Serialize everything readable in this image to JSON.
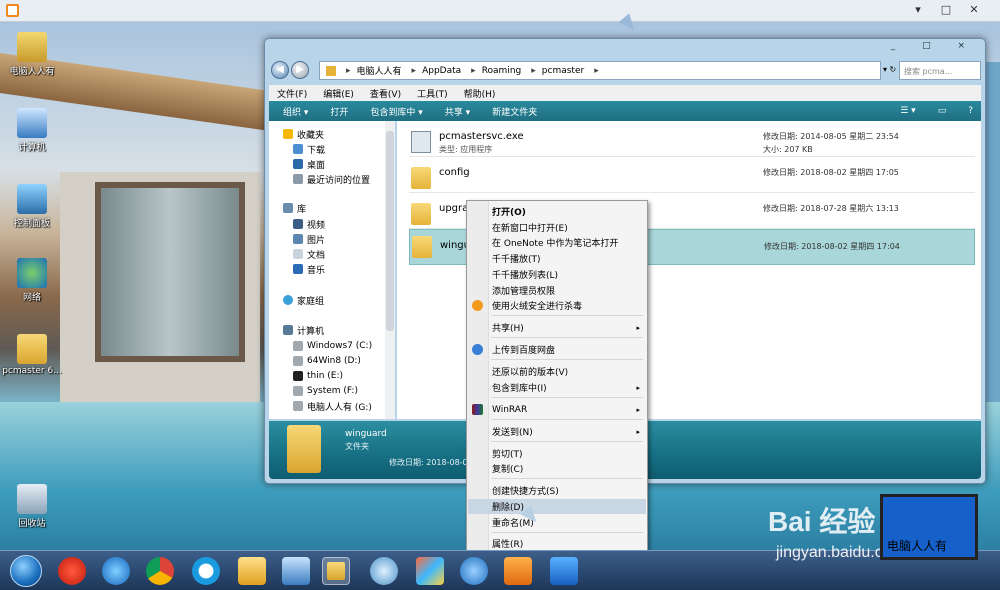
{
  "desktop": {
    "icons": [
      {
        "label": "电脑人人有"
      },
      {
        "label": "计算机"
      },
      {
        "label": "控制面板"
      },
      {
        "label": "网络"
      },
      {
        "label": "pcmaster 6..."
      },
      {
        "label": "回收站"
      }
    ]
  },
  "explorer": {
    "window_controls": "_ □ ×",
    "address": [
      "电脑人人有",
      "AppData",
      "Roaming",
      "pcmaster"
    ],
    "search_placeholder": "搜索 pcma...",
    "menu": [
      "文件(F)",
      "编辑(E)",
      "查看(V)",
      "工具(T)",
      "帮助(H)"
    ],
    "toolbar": [
      "组织 ▾",
      "打开",
      "包含到库中 ▾",
      "共享 ▾",
      "新建文件夹"
    ],
    "nav": {
      "favorites": "收藏夹",
      "fav_items": [
        "下载",
        "桌面",
        "最近访问的位置"
      ],
      "libraries": "库",
      "lib_items": [
        "视频",
        "图片",
        "文档",
        "音乐"
      ],
      "homegroup": "家庭组",
      "computer": "计算机",
      "drives": [
        "Windows7 (C:)",
        "64Win8  (D:)",
        "thin (E:)",
        "System (F:)",
        "电脑人人有 (G:)"
      ]
    },
    "files": [
      {
        "name": "pcmastersvc.exe",
        "type": "类型: 应用程序",
        "date": "修改日期: 2014-08-05 星期二 23:54",
        "size": "大小: 207 KB"
      },
      {
        "name": "config",
        "type": "",
        "date": "修改日期: 2018-08-02 星期四 17:05",
        "size": ""
      },
      {
        "name": "upgra",
        "type": "",
        "date": "修改日期: 2018-07-28 星期六 13:13",
        "size": ""
      },
      {
        "name": "wingu",
        "type": "",
        "date": "修改日期: 2018-08-02 星期四 17:04",
        "size": ""
      }
    ],
    "details": {
      "name": "winguard",
      "type": "文件夹",
      "date": "修改日期: 2018-08-0"
    }
  },
  "context_menu": {
    "items": [
      {
        "label": "打开(O)",
        "bold": true
      },
      {
        "label": "在新窗口中打开(E)"
      },
      {
        "label": "在 OneNote 中作为笔记本打开"
      },
      {
        "label": "千千播放(T)"
      },
      {
        "label": "千千播放列表(L)"
      },
      {
        "label": "添加管理员权限"
      },
      {
        "label": "使用火绒安全进行杀毒"
      },
      {
        "label": "共享(H)"
      },
      {
        "label": "上传到百度网盘"
      },
      {
        "label": "还原以前的版本(V)"
      },
      {
        "label": "包含到库中(I)"
      },
      {
        "label": "WinRAR"
      },
      {
        "label": "发送到(N)"
      },
      {
        "label": "剪切(T)"
      },
      {
        "label": "复制(C)"
      },
      {
        "label": "创建快捷方式(S)"
      },
      {
        "label": "删除(D)"
      },
      {
        "label": "重命名(M)"
      },
      {
        "label": "属性(R)"
      }
    ],
    "submenu_arrow": "▸"
  },
  "watermark": {
    "brand": "Bai 经验",
    "url": "jingyan.baidu.com",
    "screen_text": "电脑人人有"
  },
  "colors": {
    "accent": "#1f7f91",
    "selection": "#a9d7d9",
    "menu_highlight": "#c9d6e3"
  }
}
